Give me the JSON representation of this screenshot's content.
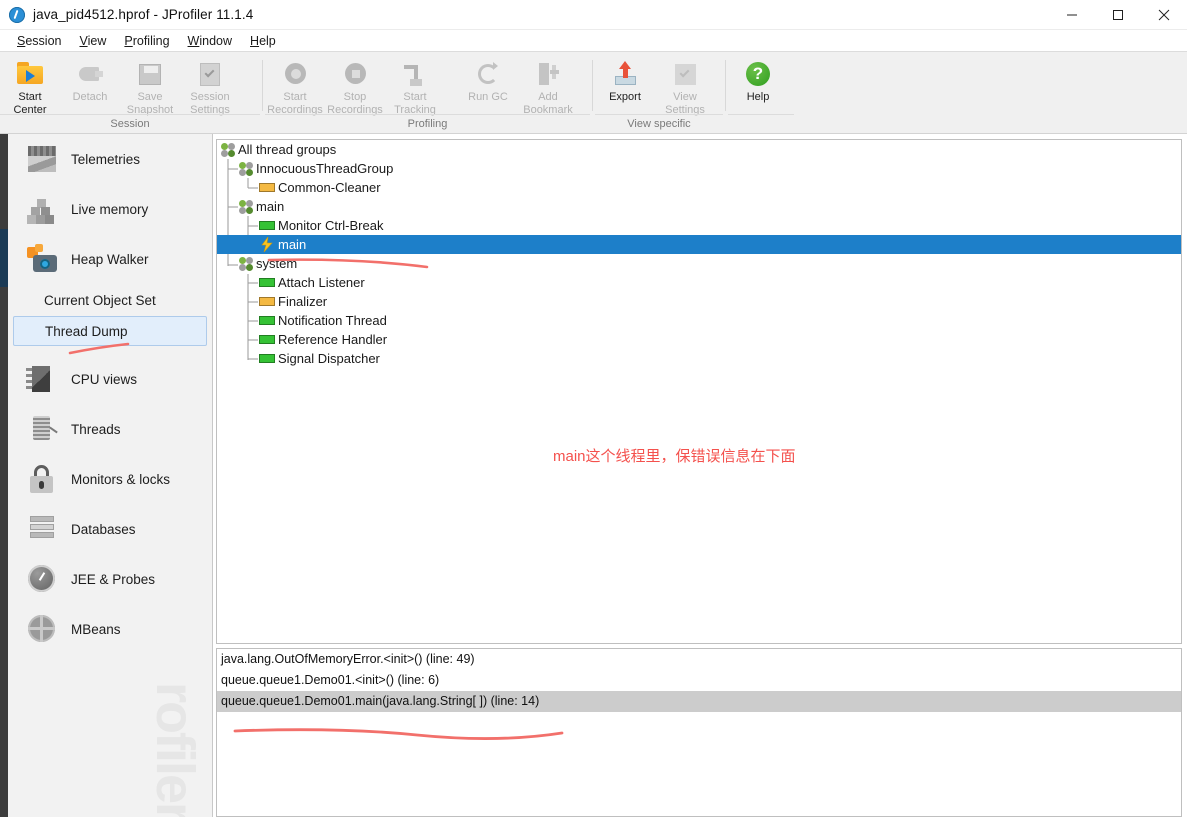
{
  "window": {
    "title": "java_pid4512.hprof - JProfiler 11.1.4",
    "app_icon": "jprofiler-icon",
    "minimize": "minimize-icon",
    "maximize": "maximize-icon",
    "close": "close-icon"
  },
  "menubar": {
    "items": [
      {
        "label": "Session",
        "mnemonic": "S"
      },
      {
        "label": "View",
        "mnemonic": "V"
      },
      {
        "label": "Profiling",
        "mnemonic": "P"
      },
      {
        "label": "Window",
        "mnemonic": "W"
      },
      {
        "label": "Help",
        "mnemonic": "H"
      }
    ]
  },
  "toolbar": {
    "groups": [
      {
        "label": "Session",
        "buttons": [
          {
            "name": "start-center",
            "line1": "Start",
            "line2": "Center",
            "icon": "folder-play-icon",
            "enabled": true
          },
          {
            "name": "detach",
            "line1": "Detach",
            "line2": "",
            "icon": "plug-icon",
            "enabled": false
          },
          {
            "name": "save-snapshot",
            "line1": "Save",
            "line2": "Snapshot",
            "icon": "floppy-icon",
            "enabled": false
          },
          {
            "name": "session-settings",
            "line1": "Session",
            "line2": "Settings",
            "icon": "settings-doc-icon",
            "enabled": false
          }
        ]
      },
      {
        "label": "Profiling",
        "buttons": [
          {
            "name": "start-recordings",
            "line1": "Start",
            "line2": "Recordings",
            "icon": "record-start-icon",
            "enabled": false
          },
          {
            "name": "stop-recordings",
            "line1": "Stop",
            "line2": "Recordings",
            "icon": "record-stop-icon",
            "enabled": false
          },
          {
            "name": "start-tracking",
            "line1": "Start",
            "line2": "Tracking",
            "icon": "tracking-icon",
            "enabled": false
          },
          {
            "name": "run-gc",
            "line1": "Run GC",
            "line2": "",
            "icon": "refresh-gc-icon",
            "enabled": false
          },
          {
            "name": "add-bookmark",
            "line1": "Add",
            "line2": "Bookmark",
            "icon": "bookmark-icon",
            "enabled": false
          }
        ]
      },
      {
        "label": "View specific",
        "buttons": [
          {
            "name": "export",
            "line1": "Export",
            "line2": "",
            "icon": "export-arrow-icon",
            "enabled": true
          },
          {
            "name": "view-settings",
            "line1": "View",
            "line2": "Settings",
            "icon": "view-settings-icon",
            "enabled": false
          },
          {
            "name": "help",
            "line1": "Help",
            "line2": "",
            "icon": "help-circle-icon",
            "enabled": true
          }
        ]
      }
    ]
  },
  "sidebar": {
    "items": [
      {
        "label": "Telemetries",
        "icon": "telemetries-icon",
        "type": "item",
        "selected": false
      },
      {
        "label": "Live memory",
        "icon": "live-memory-icon",
        "type": "item",
        "selected": false
      },
      {
        "label": "Heap Walker",
        "icon": "heap-walker-icon",
        "type": "item",
        "selected": false
      },
      {
        "label": "Current Object Set",
        "icon": "",
        "type": "sub",
        "selected": false
      },
      {
        "label": "Thread Dump",
        "icon": "",
        "type": "sub",
        "selected": true
      },
      {
        "label": "CPU views",
        "icon": "cpu-views-icon",
        "type": "item",
        "selected": false
      },
      {
        "label": "Threads",
        "icon": "threads-icon",
        "type": "item",
        "selected": false
      },
      {
        "label": "Monitors & locks",
        "icon": "monitors-locks-icon",
        "type": "item",
        "selected": false
      },
      {
        "label": "Databases",
        "icon": "databases-icon",
        "type": "item",
        "selected": false
      },
      {
        "label": "JEE & Probes",
        "icon": "jee-probes-icon",
        "type": "item",
        "selected": false
      },
      {
        "label": "MBeans",
        "icon": "mbeans-icon",
        "type": "item",
        "selected": false
      }
    ],
    "watermark": "rofiler"
  },
  "thread_tree": {
    "rows": [
      {
        "label": "All thread groups",
        "depth": 0,
        "icon": "thread-group-icon",
        "selected": false
      },
      {
        "label": "InnocuousThreadGroup",
        "depth": 1,
        "icon": "thread-group-icon",
        "selected": false
      },
      {
        "label": "Common-Cleaner",
        "depth": 2,
        "icon": "thread-waiting-icon",
        "selected": false
      },
      {
        "label": "main",
        "depth": 1,
        "icon": "thread-group-icon",
        "selected": false
      },
      {
        "label": "Monitor Ctrl-Break",
        "depth": 2,
        "icon": "thread-runnable-icon",
        "selected": false
      },
      {
        "label": "main",
        "depth": 2,
        "icon": "thread-bolt-icon",
        "selected": true
      },
      {
        "label": "system",
        "depth": 1,
        "icon": "thread-group-icon",
        "selected": false
      },
      {
        "label": "Attach Listener",
        "depth": 2,
        "icon": "thread-runnable-icon",
        "selected": false
      },
      {
        "label": "Finalizer",
        "depth": 2,
        "icon": "thread-waiting-icon",
        "selected": false
      },
      {
        "label": "Notification Thread",
        "depth": 2,
        "icon": "thread-runnable-icon",
        "selected": false
      },
      {
        "label": "Reference Handler",
        "depth": 2,
        "icon": "thread-runnable-icon",
        "selected": false
      },
      {
        "label": "Signal Dispatcher",
        "depth": 2,
        "icon": "thread-runnable-icon",
        "selected": false
      }
    ]
  },
  "stack_trace": {
    "rows": [
      {
        "text": "java.lang.OutOfMemoryError.<init>() (line: 49)",
        "selected": false
      },
      {
        "text": "queue.queue1.Demo01.<init>() (line: 6)",
        "selected": false
      },
      {
        "text": "queue.queue1.Demo01.main(java.lang.String[ ]) (line: 14)",
        "selected": true
      }
    ]
  },
  "annotations": {
    "note_text": "main这个线程里，保错误信息在下面",
    "note_color": "#f4514d",
    "underline_color": "#f2706b"
  },
  "colors": {
    "selection_blue": "#1d7fc9",
    "sidebar_selection": "#e2eefb",
    "stack_selection": "#cccccc",
    "thread_runnable": "#35c235",
    "thread_waiting": "#f4b942",
    "accent_edge": "#1b3a55"
  }
}
